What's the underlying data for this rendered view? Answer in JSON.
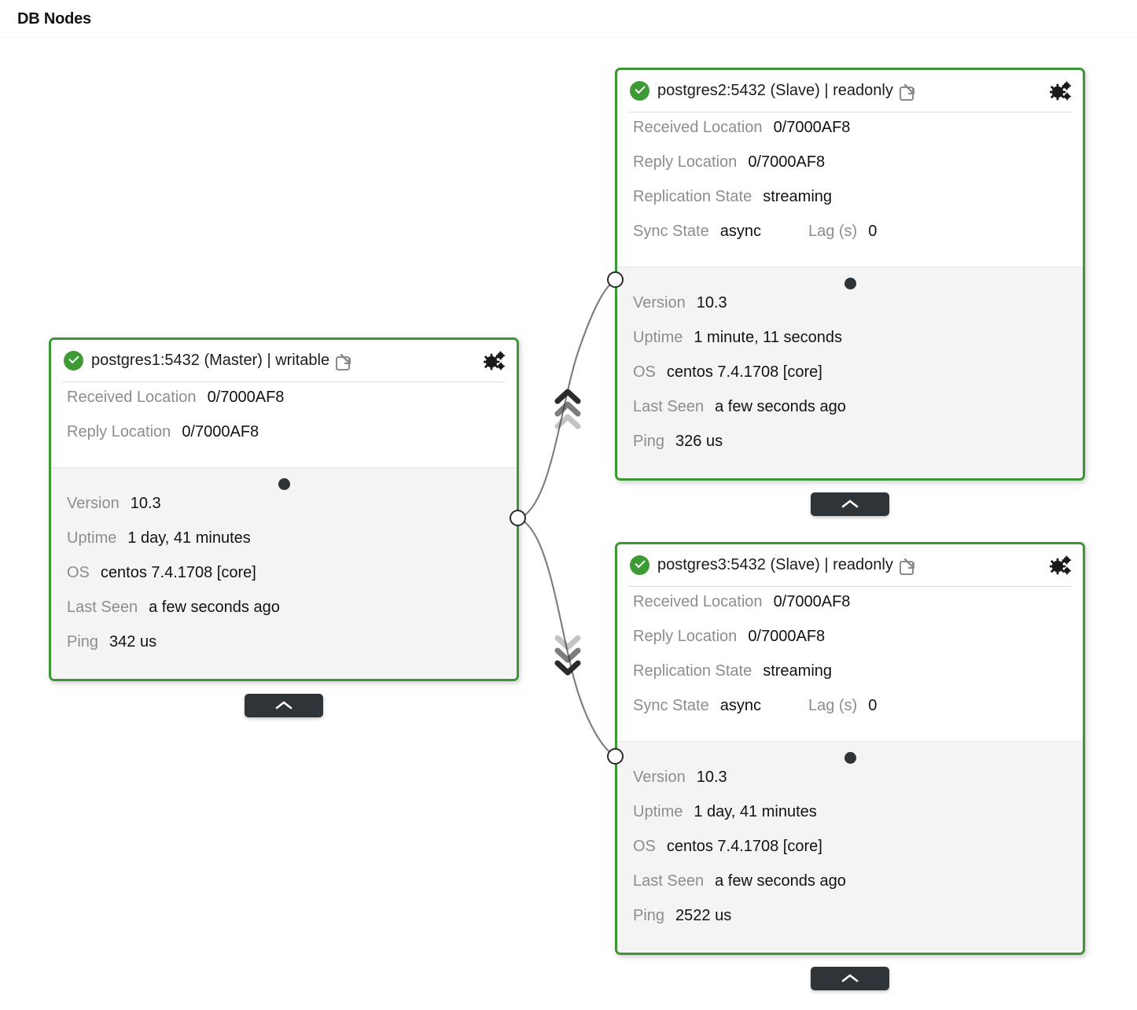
{
  "header": {
    "title": "DB Nodes"
  },
  "icons": {
    "status_ok": "check-circle-icon",
    "external_link": "external-link-icon",
    "settings": "cogs-icon",
    "collapse": "chevron-up-icon",
    "drag_handle": "drag-handle-dot"
  },
  "colors": {
    "node_border": "#3d9635",
    "status_ok": "#3d9b35",
    "label": "#8d8d8d",
    "value": "#121212",
    "footer_bg": "#f4f4f4",
    "tab_bg": "#2e3438",
    "edge": "#7c7c7c"
  },
  "labels": {
    "received_location": "Received Location",
    "reply_location": "Reply Location",
    "replication_state": "Replication State",
    "sync_state": "Sync State",
    "lag": "Lag (s)",
    "version": "Version",
    "uptime": "Uptime",
    "os": "OS",
    "last_seen": "Last Seen",
    "ping": "Ping"
  },
  "nodes": [
    {
      "id": "postgres1",
      "title": "postgres1:5432 (Master) | writable",
      "status": "ok",
      "received_location": "0/7000AF8",
      "reply_location": "0/7000AF8",
      "replication_state": null,
      "sync_state": null,
      "lag": null,
      "version": "10.3",
      "uptime": "1 day, 41 minutes",
      "os": "centos 7.4.1708 [core]",
      "last_seen": "a few seconds ago",
      "ping": "342 us"
    },
    {
      "id": "postgres2",
      "title": "postgres2:5432 (Slave) | readonly",
      "status": "ok",
      "received_location": "0/7000AF8",
      "reply_location": "0/7000AF8",
      "replication_state": "streaming",
      "sync_state": "async",
      "lag": "0",
      "version": "10.3",
      "uptime": "1 minute, 11 seconds",
      "os": "centos 7.4.1708 [core]",
      "last_seen": "a few seconds ago",
      "ping": "326 us"
    },
    {
      "id": "postgres3",
      "title": "postgres3:5432 (Slave) | readonly",
      "status": "ok",
      "received_location": "0/7000AF8",
      "reply_location": "0/7000AF8",
      "replication_state": "streaming",
      "sync_state": "async",
      "lag": "0",
      "version": "10.3",
      "uptime": "1 day, 41 minutes",
      "os": "centos 7.4.1708 [core]",
      "last_seen": "a few seconds ago",
      "ping": "2522 us"
    }
  ],
  "edges": [
    {
      "from": "postgres1",
      "to": "postgres2",
      "direction": "up"
    },
    {
      "from": "postgres1",
      "to": "postgres3",
      "direction": "down"
    }
  ]
}
